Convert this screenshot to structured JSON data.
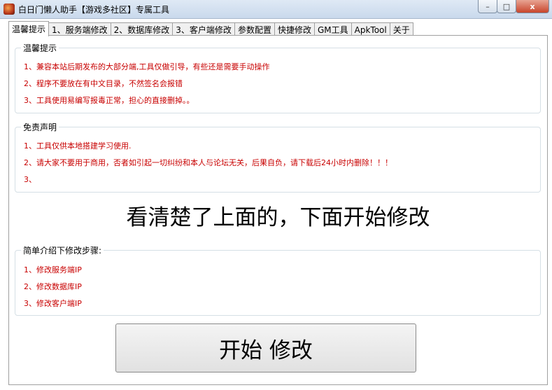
{
  "window": {
    "title": "白日门懒人助手【游戏多社区】专属工具",
    "minimize_glyph": "–",
    "maximize_glyph": "□",
    "close_glyph": "x"
  },
  "tabs": [
    "温馨提示",
    "1、服务端修改",
    "2、数据库修改",
    "3、客户端修改",
    "参数配置",
    "快捷修改",
    "GM工具",
    "ApkTool",
    "关于"
  ],
  "tips": {
    "title": "温馨提示",
    "lines": [
      "1、兼容本站后期发布的大部分端,工具仅做引导，有些还是需要手动操作",
      "2、程序不要放在有中文目录，不然签名会报错",
      "3、工具使用易编写报毒正常，担心的直接删掉。。"
    ]
  },
  "disclaimer": {
    "title": "免责声明",
    "lines": [
      "1、工具仅供本地搭建学习使用.",
      "2、请大家不要用于商用，否者如引起一切纠纷和本人与论坛无关，后果自负，请下载后24小时内删除！！！",
      "3、"
    ]
  },
  "headline": "看清楚了上面的，下面开始修改",
  "steps": {
    "title": "简单介绍下修改步骤:",
    "lines": [
      "1、修改服务端IP",
      "2、修改数据库IP",
      "3、修改客户端IP"
    ]
  },
  "start_button": "开始 修改",
  "colors": {
    "warning_text": "#c80000",
    "title_bar": "#c9d9ec"
  }
}
